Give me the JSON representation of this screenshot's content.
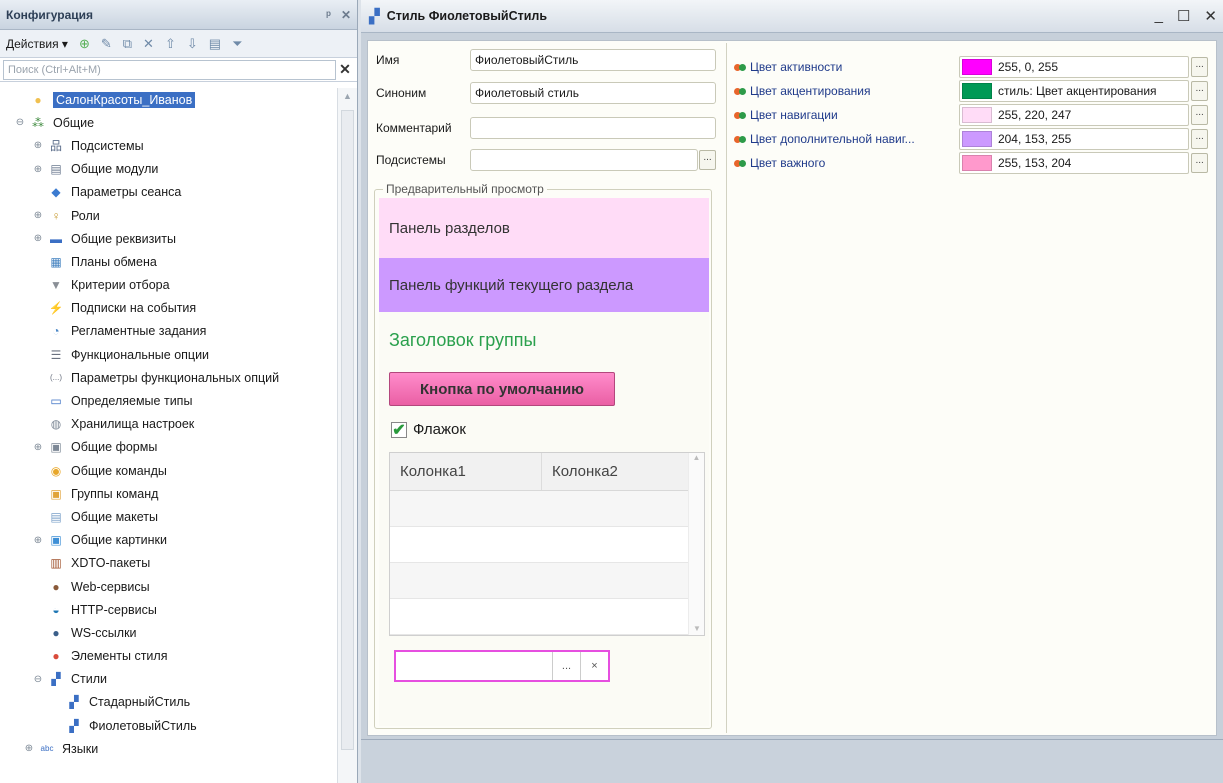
{
  "config": {
    "title": "Конфигурация",
    "pin_glyph": "ᵖ",
    "close_glyph": "✕",
    "actions_label": "Действия ▾",
    "search_placeholder": "Поиск (Ctrl+Alt+M)",
    "search_clear": "✕",
    "tree": [
      {
        "label": "СалонКрасоты_Иванов",
        "icon": "config-root-icon",
        "glyph": "●",
        "color": "#f0c050",
        "indent": 0,
        "expander": "",
        "selected": true
      },
      {
        "label": "Общие",
        "icon": "common-icon",
        "glyph": "⁂",
        "color": "#3f8a3f",
        "indent": 0,
        "expander": "⊖"
      },
      {
        "label": "Подсистемы",
        "icon": "subsystems-icon",
        "glyph": "品",
        "color": "#5b6d8a",
        "indent": 1,
        "expander": "⊕"
      },
      {
        "label": "Общие модули",
        "icon": "common-modules-icon",
        "glyph": "▤",
        "color": "#6b7a90",
        "indent": 1,
        "expander": "⊕"
      },
      {
        "label": "Параметры сеанса",
        "icon": "session-params-icon",
        "glyph": "◆",
        "color": "#3b7bd0",
        "indent": 1,
        "expander": ""
      },
      {
        "label": "Роли",
        "icon": "roles-icon",
        "glyph": "♀",
        "color": "#c79a30",
        "indent": 1,
        "expander": "⊕"
      },
      {
        "label": "Общие реквизиты",
        "icon": "common-attributes-icon",
        "glyph": "▬",
        "color": "#3b6fc4",
        "indent": 1,
        "expander": "⊕"
      },
      {
        "label": "Планы обмена",
        "icon": "exchange-plans-icon",
        "glyph": "▦",
        "color": "#3f7fbf",
        "indent": 1,
        "expander": ""
      },
      {
        "label": "Критерии отбора",
        "icon": "filter-criteria-icon",
        "glyph": "▼",
        "color": "#8a8f96",
        "indent": 1,
        "expander": ""
      },
      {
        "label": "Подписки на события",
        "icon": "event-subscriptions-icon",
        "glyph": "⚡",
        "color": "#c9a32a",
        "indent": 1,
        "expander": ""
      },
      {
        "label": "Регламентные задания",
        "icon": "scheduled-jobs-icon",
        "glyph": "◔",
        "color": "#4d88c7",
        "indent": 1,
        "expander": ""
      },
      {
        "label": "Функциональные опции",
        "icon": "functional-options-icon",
        "glyph": "☰",
        "color": "#6b7280",
        "indent": 1,
        "expander": ""
      },
      {
        "label": "Параметры функциональных опций",
        "icon": "functional-option-params-icon",
        "glyph": "(...)",
        "color": "#6b7280",
        "indent": 1,
        "expander": ""
      },
      {
        "label": "Определяемые типы",
        "icon": "defined-types-icon",
        "glyph": "▭",
        "color": "#3b6fc4",
        "indent": 1,
        "expander": ""
      },
      {
        "label": "Хранилища настроек",
        "icon": "settings-storages-icon",
        "glyph": "◍",
        "color": "#7d8896",
        "indent": 1,
        "expander": ""
      },
      {
        "label": "Общие формы",
        "icon": "common-forms-icon",
        "glyph": "▣",
        "color": "#7d8896",
        "indent": 1,
        "expander": "⊕"
      },
      {
        "label": "Общие команды",
        "icon": "common-commands-icon",
        "glyph": "◉",
        "color": "#e8a72a",
        "indent": 1,
        "expander": ""
      },
      {
        "label": "Группы команд",
        "icon": "command-groups-icon",
        "glyph": "▣",
        "color": "#e0a33a",
        "indent": 1,
        "expander": ""
      },
      {
        "label": "Общие макеты",
        "icon": "common-templates-icon",
        "glyph": "▤",
        "color": "#7aa0c8",
        "indent": 1,
        "expander": ""
      },
      {
        "label": "Общие картинки",
        "icon": "common-pictures-icon",
        "glyph": "▣",
        "color": "#3e8fd6",
        "indent": 1,
        "expander": "⊕"
      },
      {
        "label": "XDTO-пакеты",
        "icon": "xdto-packages-icon",
        "glyph": "▥",
        "color": "#a0522d",
        "indent": 1,
        "expander": ""
      },
      {
        "label": "Web-сервисы",
        "icon": "web-services-icon",
        "glyph": "●",
        "color": "#8a5a3a",
        "indent": 1,
        "expander": ""
      },
      {
        "label": "HTTP-сервисы",
        "icon": "http-services-icon",
        "glyph": "◒",
        "color": "#1f77b4",
        "indent": 1,
        "expander": ""
      },
      {
        "label": "WS-ссылки",
        "icon": "ws-links-icon",
        "glyph": "●",
        "color": "#3b5f8a",
        "indent": 1,
        "expander": ""
      },
      {
        "label": "Элементы стиля",
        "icon": "style-items-icon",
        "glyph": "●",
        "color": "#d94b3b",
        "indent": 1,
        "expander": ""
      },
      {
        "label": "Стили",
        "icon": "styles-icon",
        "glyph": "▞",
        "color": "#3b6fc4",
        "indent": 1,
        "expander": "⊖"
      },
      {
        "label": "СтадарныйСтиль",
        "icon": "style-icon",
        "glyph": "▞",
        "color": "#3b6fc4",
        "indent": 2,
        "expander": ""
      },
      {
        "label": "ФиолетовыйСтиль",
        "icon": "style-icon",
        "glyph": "▞",
        "color": "#3b6fc4",
        "indent": 2,
        "expander": ""
      },
      {
        "label": "Языки",
        "icon": "languages-icon",
        "glyph": "abc",
        "color": "#3b6fc4",
        "indent": 0.5,
        "expander": "⊕"
      }
    ]
  },
  "window": {
    "title": "Стиль ФиолетовыйСтиль",
    "minimize": "_",
    "maximize": "☐",
    "close": "✕"
  },
  "form": {
    "name_label": "Имя",
    "name_value": "ФиолетовыйСтиль",
    "synonym_label": "Синоним",
    "synonym_value": "Фиолетовый стиль",
    "comment_label": "Комментарий",
    "comment_value": "",
    "subsystems_label": "Подсистемы",
    "subsystems_value": "",
    "dots": "..."
  },
  "preview": {
    "legend": "Предварительный просмотр",
    "sections_panel": "Панель разделов",
    "functions_panel": "Панель функций текущего раздела",
    "group_title": "Заголовок группы",
    "default_button": "Кнопка по умолчанию",
    "checkbox_label": "Флажок",
    "checkbox_mark": "✔",
    "column1": "Колонка1",
    "column2": "Колонка2",
    "input_dots": "...",
    "input_clear": "×"
  },
  "colors": [
    {
      "label": "Цвет активности",
      "value": "255, 0, 255",
      "swatch": "#ff00ff"
    },
    {
      "label": "Цвет акцентирования",
      "value": "стиль: Цвет акцентирования",
      "swatch": "#009955"
    },
    {
      "label": "Цвет навигации",
      "value": "255, 220, 247",
      "swatch": "#ffdcf7"
    },
    {
      "label": "Цвет дополнительной навиг...",
      "value": "204, 153, 255",
      "swatch": "#cc99ff"
    },
    {
      "label": "Цвет важного",
      "value": "255, 153, 204",
      "swatch": "#ff99cc"
    }
  ]
}
